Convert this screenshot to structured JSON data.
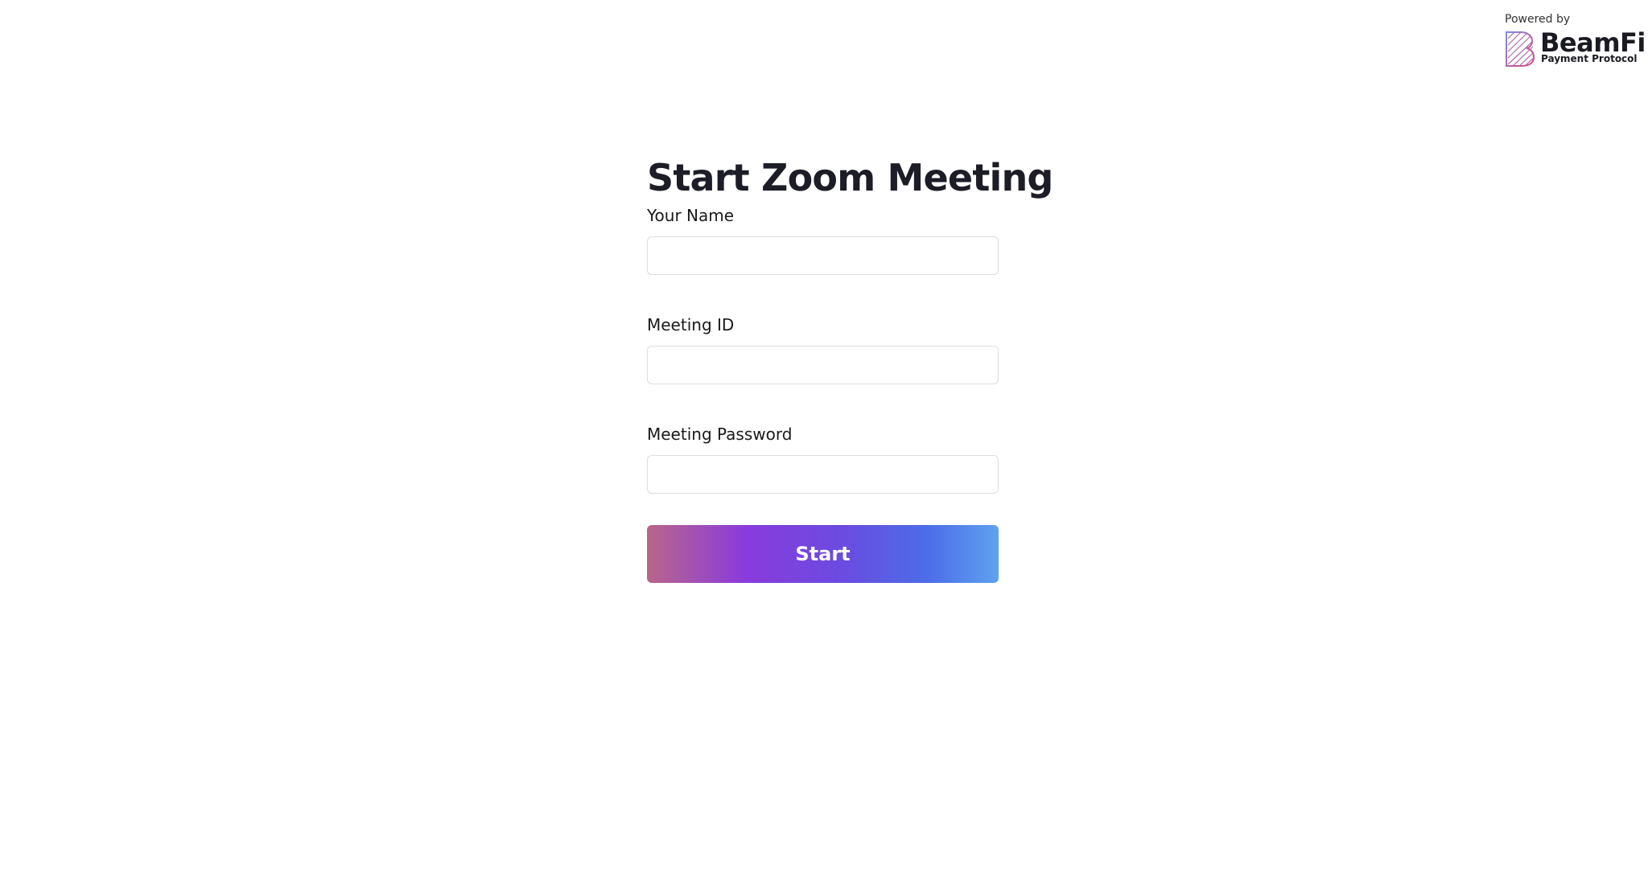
{
  "branding": {
    "powered_by": "Powered by",
    "name": "BeamFi",
    "tagline": "Payment Protocol",
    "logo_icon": "beamfi-logo-icon",
    "colors": {
      "logo_pink": "#e0427a",
      "logo_blue": "#7c8ee6"
    }
  },
  "form": {
    "title": "Start Zoom Meeting",
    "fields": [
      {
        "label": "Your Name",
        "value": "",
        "placeholder": ""
      },
      {
        "label": "Meeting ID",
        "value": "",
        "placeholder": ""
      },
      {
        "label": "Meeting Password",
        "value": "",
        "placeholder": ""
      }
    ],
    "submit_label": "Start"
  },
  "colors": {
    "button_gradient_start": "#b9668a",
    "button_gradient_mid": "#8a3bdd",
    "button_gradient_end": "#5ea2ee",
    "title_text": "#1c1d27"
  }
}
